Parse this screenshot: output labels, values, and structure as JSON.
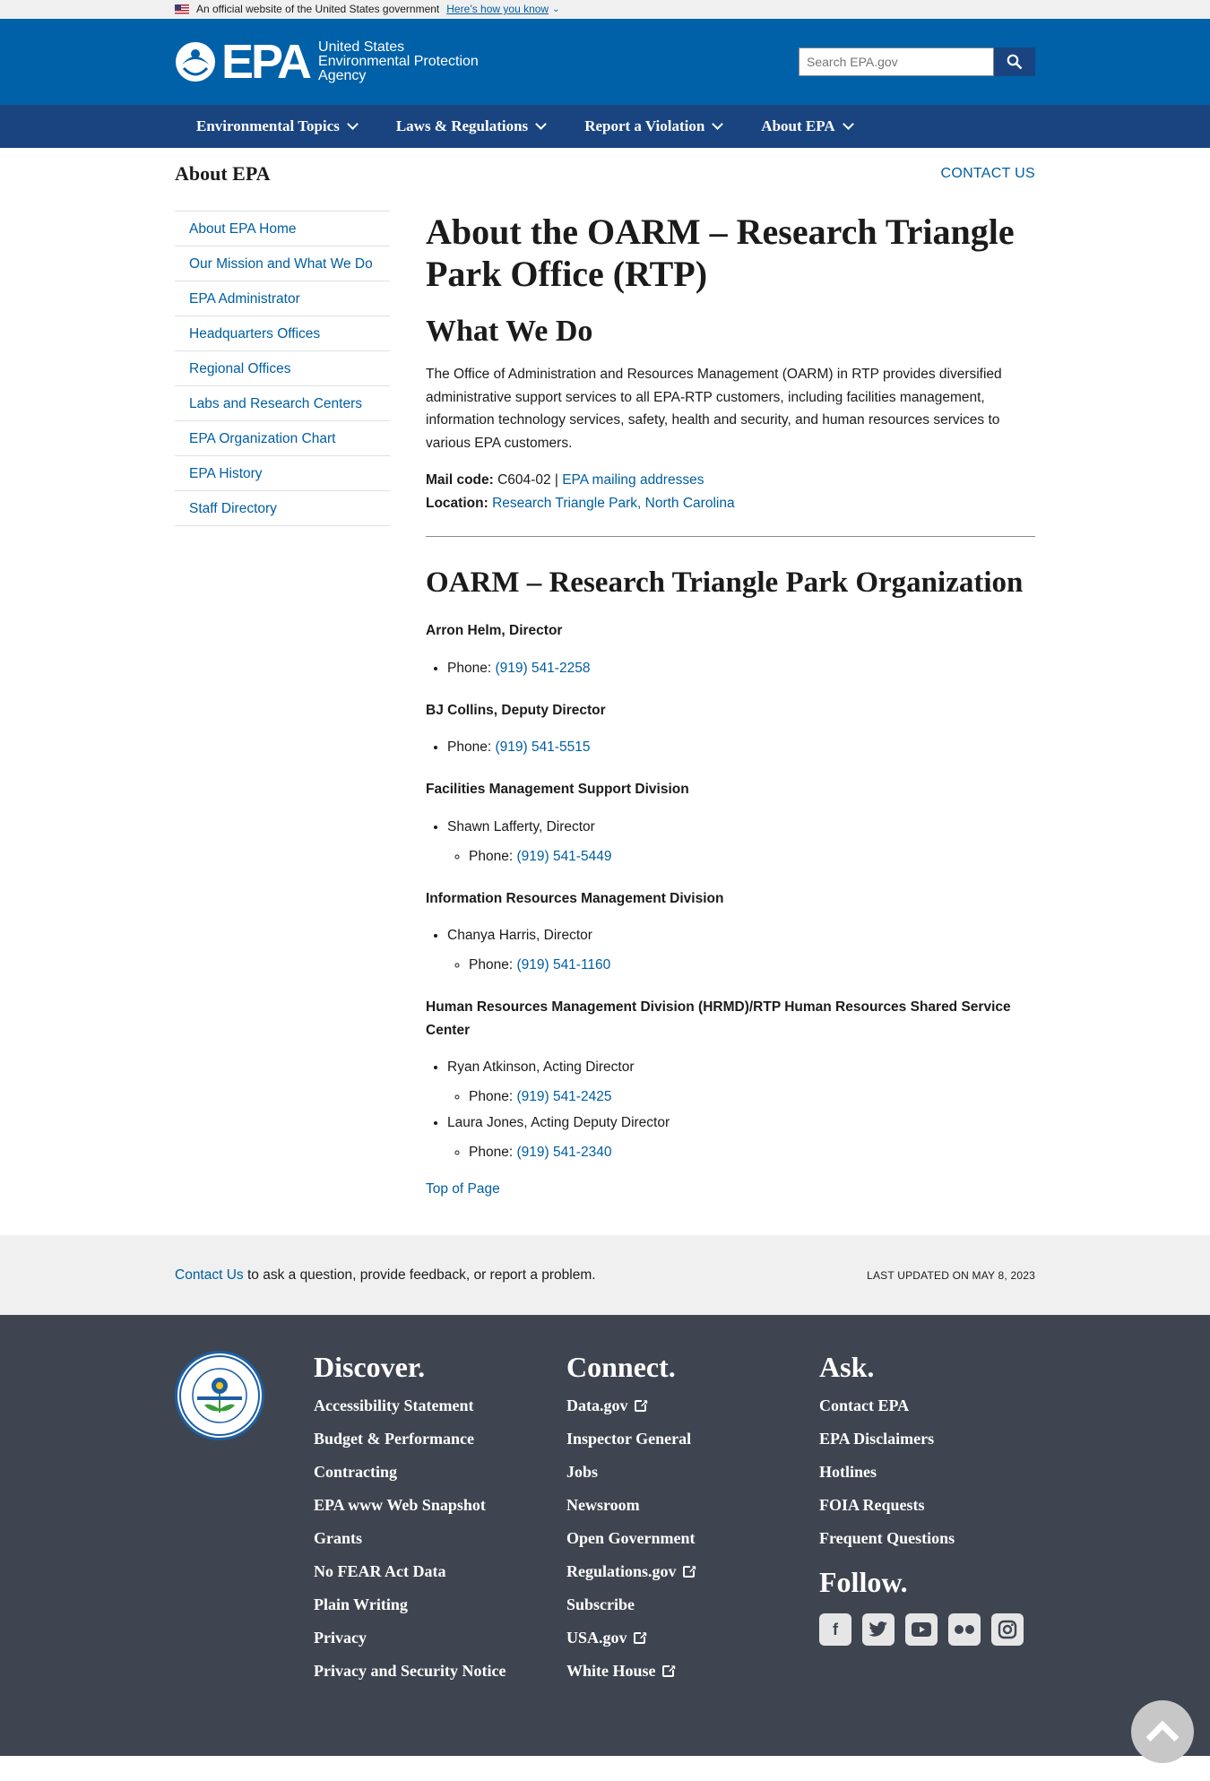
{
  "gov_banner": {
    "text": "An official website of the United States government",
    "link": "Here’s how you know"
  },
  "header": {
    "logo_text": "EPA",
    "agency_line1": "United States",
    "agency_line2": "Environmental Protection",
    "agency_line3": "Agency",
    "search_placeholder": "Search EPA.gov"
  },
  "nav": {
    "items": [
      {
        "label": "Environmental Topics"
      },
      {
        "label": "Laws & Regulations"
      },
      {
        "label": "Report a Violation"
      },
      {
        "label": "About EPA"
      }
    ]
  },
  "subheader": {
    "title": "About EPA",
    "contact": "CONTACT US"
  },
  "sidenav": {
    "items": [
      {
        "label": "About EPA Home"
      },
      {
        "label": "Our Mission and What We Do"
      },
      {
        "label": "EPA Administrator"
      },
      {
        "label": "Headquarters Offices"
      },
      {
        "label": "Regional Offices"
      },
      {
        "label": "Labs and Research Centers"
      },
      {
        "label": "EPA Organization Chart"
      },
      {
        "label": "EPA History"
      },
      {
        "label": "Staff Directory"
      }
    ]
  },
  "main": {
    "title": "About the OARM – Research Triangle Park Office (RTP)",
    "what_we_do": "What We Do",
    "description": "The Office of Administration and Resources Management (OARM) in RTP provides diversified administrative support services to all EPA-RTP customers, including facilities management, information technology services, safety, health and security, and human resources services to various EPA customers.",
    "mail_code_label": "Mail code:",
    "mail_code": "C604-02 |",
    "mail_link": "EPA mailing addresses",
    "location_label": "Location:",
    "location_link": "Research Triangle Park, North Carolina",
    "org_title": "OARM – Research Triangle Park Organization",
    "phone_label": "Phone:",
    "director": {
      "name": "Arron Helm, Director",
      "phone": "(919) 541-2258"
    },
    "deputy": {
      "name": "BJ Collins, Deputy Director",
      "phone": "(919) 541-5515"
    },
    "fmsd": {
      "heading": "Facilities Management Support Division",
      "person": "Shawn Lafferty, Director",
      "phone": "(919) 541-5449"
    },
    "irmd": {
      "heading": "Information Resources Management Division",
      "person": "Chanya Harris, Director",
      "phone": "(919) 541-1160"
    },
    "hrmd": {
      "heading": "Human Resources Management Division (HRMD)/RTP Human Resources Shared Service Center",
      "person1": "Ryan Atkinson, Acting Director",
      "phone1": "(919) 541-2425",
      "person2": "Laura Jones, Acting Deputy Director",
      "phone2": "(919) 541-2340"
    },
    "top_of_page": "Top of Page"
  },
  "feedback": {
    "contact_link": "Contact Us",
    "text": " to ask a question, provide feedback, or report a problem.",
    "updated": "LAST UPDATED ON MAY 8, 2023"
  },
  "footer": {
    "seal_text": "UNITED STATES ENVIRONMENTAL PROTECTION AGENCY",
    "discover": {
      "title": "Discover.",
      "links": [
        "Accessibility Statement",
        "Budget & Performance",
        "Contracting",
        "EPA www Web Snapshot",
        "Grants",
        "No FEAR Act Data",
        "Plain Writing",
        "Privacy",
        "Privacy and Security Notice"
      ]
    },
    "connect": {
      "title": "Connect.",
      "links": [
        "Data.gov",
        "Inspector General",
        "Jobs",
        "Newsroom",
        "Open Government",
        "Regulations.gov",
        "Subscribe",
        "USA.gov",
        "White House"
      ]
    },
    "ask": {
      "title": "Ask.",
      "links": [
        "Contact EPA",
        "EPA Disclaimers",
        "Hotlines",
        "FOIA Requests",
        "Frequent Questions"
      ]
    },
    "follow": {
      "title": "Follow.",
      "icons": [
        "facebook-icon",
        "twitter-icon",
        "youtube-icon",
        "flickr-icon",
        "instagram-icon"
      ]
    }
  },
  "colors": {
    "header": "#0061a8",
    "nav": "#1a4480",
    "link": "#005ea2",
    "footer": "#3f4550"
  }
}
